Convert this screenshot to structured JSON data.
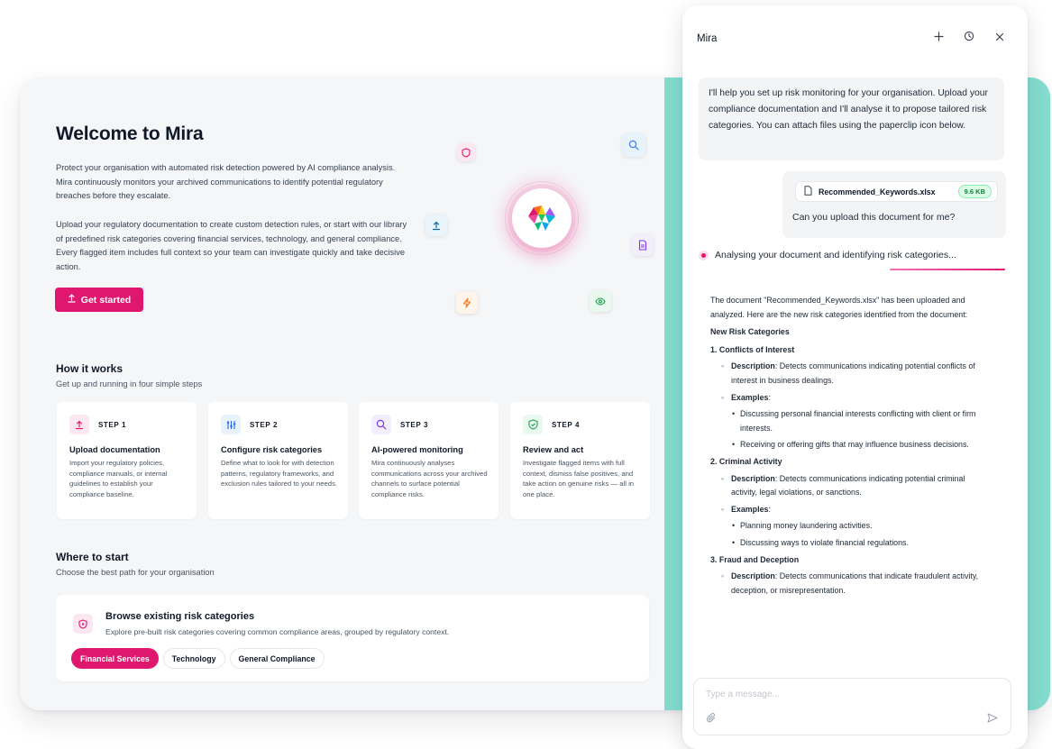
{
  "colors": {
    "brand": "#e0176f",
    "teal": "#84dccf",
    "success": "#15803d"
  },
  "hero": {
    "title": "Welcome to Mira",
    "para1": "Protect your organisation with automated risk detection powered by AI compliance analysis. Mira continuously monitors your archived communications to identify potential regulatory breaches before they escalate.",
    "para2": "Upload your regulatory documentation to create custom detection rules, or start with our library of predefined risk categories covering financial services, technology, and general compliance. Every flagged item includes full context so your team can investigate quickly and take decisive action.",
    "cta_label": "Get started",
    "cta_icon": "upload-icon"
  },
  "illustration": {
    "logo_icon": "mira-logo",
    "floating_icons": [
      "shield-icon",
      "search-icon",
      "upload-icon",
      "document-icon",
      "lightning-icon",
      "eye-icon"
    ]
  },
  "how_it_works": {
    "title": "How it works",
    "subtitle": "Get up and running in four simple steps",
    "steps": [
      {
        "label": "STEP 1",
        "icon": "upload-icon",
        "name": "Upload documentation",
        "desc": "Import your regulatory policies, compliance manuals, or internal guidelines to establish your compliance baseline."
      },
      {
        "label": "STEP 2",
        "icon": "sliders-icon",
        "name": "Configure risk categories",
        "desc": "Define what to look for with detection patterns, regulatory frameworks, and exclusion rules tailored to your needs."
      },
      {
        "label": "STEP 3",
        "icon": "search-icon",
        "name": "AI-powered monitoring",
        "desc": "Mira continuously analyses communications across your archived channels to surface potential compliance risks."
      },
      {
        "label": "STEP 4",
        "icon": "shield-check-icon",
        "name": "Review and act",
        "desc": "Investigate flagged items with full context, dismiss false positives, and take action on genuine risks — all in one place."
      }
    ]
  },
  "where_to_start": {
    "title": "Where to start",
    "subtitle": "Choose the best path for your organisation",
    "browse": {
      "title": "Browse existing risk categories",
      "desc": "Explore pre-built risk categories covering common compliance areas, grouped by regulatory context.",
      "chips": [
        "Financial Services",
        "Technology",
        "General Compliance"
      ]
    }
  },
  "chat": {
    "title": "Mira",
    "actions": [
      "plus-icon",
      "history-icon",
      "close-icon"
    ],
    "bot_intro": "I'll help you set up risk monitoring for your organisation. Upload your compliance documentation and I'll analyse it to propose tailored risk categories. You can attach files using the paperclip icon below.",
    "user_file": {
      "name": "Recommended_Keywords.xlsx",
      "size": "9.6 KB"
    },
    "user_text": "Can you upload this document for me?",
    "status": "Analysing your document and identifying risk categories...",
    "answer": {
      "intro": "The document \"Recommended_Keywords.xlsx\" has been uploaded and analyzed. Here are the new risk categories identified from the document:",
      "heading": "New Risk Categories",
      "desc_label": "Description",
      "examples_label": "Examples",
      "categories": [
        {
          "num": "1.",
          "name": "Conflicts of Interest",
          "desc": ": Detects communications indicating potential conflicts of interest in business dealings.",
          "examples": [
            "Discussing personal financial interests conflicting with client or firm interests.",
            "Receiving or offering gifts that may influence business decisions."
          ]
        },
        {
          "num": "2.",
          "name": "Criminal Activity",
          "desc": ": Detects communications indicating potential criminal activity, legal violations, or sanctions.",
          "examples": [
            "Planning money laundering activities.",
            "Discussing ways to violate financial regulations."
          ]
        },
        {
          "num": "3.",
          "name": "Fraud and Deception",
          "desc": ": Detects communications that indicate fraudulent activity, deception, or misrepresentation."
        }
      ]
    },
    "composer_placeholder": "Type a message..."
  }
}
